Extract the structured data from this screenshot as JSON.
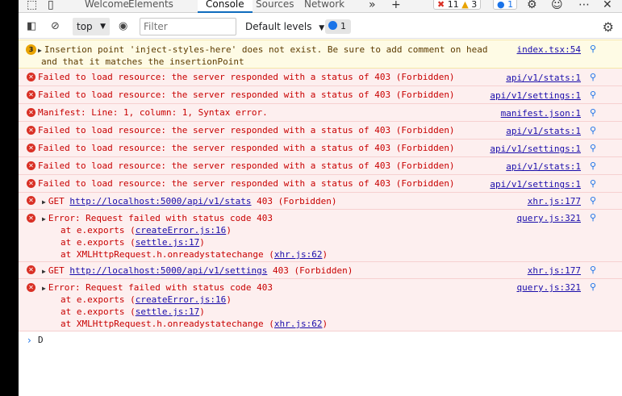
{
  "tabs": [
    {
      "label": "Welcome"
    },
    {
      "label": "Elements"
    },
    {
      "label": "Console",
      "active": true
    },
    {
      "label": "Sources"
    },
    {
      "label": "Network"
    }
  ],
  "tab_badges": {
    "errors": "11",
    "warnings": "3",
    "messages": "1"
  },
  "toolbar": {
    "context": "top",
    "filter_placeholder": "Filter",
    "levels": "Default levels",
    "message_count": "1"
  },
  "entries": [
    {
      "level": "warning",
      "badge": "3",
      "lines": [
        "Insertion point 'inject-styles-here' does not exist. Be sure to add comment on head",
        "and that it matches the insertionPoint"
      ],
      "source": "index.tsx:54"
    },
    {
      "level": "error",
      "text": "Failed to load resource: the server responded with a status of 403 (Forbidden)",
      "source": "api/v1/stats:1"
    },
    {
      "level": "error",
      "text": "Failed to load resource: the server responded with a status of 403 (Forbidden)",
      "source": "api/v1/settings:1"
    },
    {
      "level": "error",
      "text": "Manifest: Line: 1, column: 1, Syntax error.",
      "source": "manifest.json:1"
    },
    {
      "level": "error",
      "text": "Failed to load resource: the server responded with a status of 403 (Forbidden)",
      "source": "api/v1/stats:1"
    },
    {
      "level": "error",
      "text": "Failed to load resource: the server responded with a status of 403 (Forbidden)",
      "source": "api/v1/settings:1"
    },
    {
      "level": "error",
      "text": "Failed to load resource: the server responded with a status of 403 (Forbidden)",
      "source": "api/v1/stats:1"
    },
    {
      "level": "error",
      "text": "Failed to load resource: the server responded with a status of 403 (Forbidden)",
      "source": "api/v1/settings:1"
    }
  ],
  "requests": [
    {
      "method": "GET",
      "url": "http://localhost:5000/api/v1/stats",
      "status": "403 (Forbidden)",
      "source": "xhr.js:177",
      "error": {
        "message": "Error: Request failed with status code 403",
        "source": "query.js:321",
        "stack": [
          {
            "prefix": "at e.exports (",
            "link": "createError.js:16",
            "suffix": ")"
          },
          {
            "prefix": "at e.exports (",
            "link": "settle.js:17",
            "suffix": ")"
          },
          {
            "prefix": "at XMLHttpRequest.h.onreadystatechange (",
            "link": "xhr.js:62",
            "suffix": ")"
          }
        ]
      }
    },
    {
      "method": "GET",
      "url": "http://localhost:5000/api/v1/settings",
      "status": "403 (Forbidden)",
      "source": "xhr.js:177",
      "error": {
        "message": "Error: Request failed with status code 403",
        "source": "query.js:321",
        "stack": [
          {
            "prefix": "at e.exports (",
            "link": "createError.js:16",
            "suffix": ")"
          },
          {
            "prefix": "at e.exports (",
            "link": "settle.js:17",
            "suffix": ")"
          },
          {
            "prefix": "at XMLHttpRequest.h.onreadystatechange (",
            "link": "xhr.js:62",
            "suffix": ")"
          }
        ]
      }
    }
  ],
  "prompt_input": "D",
  "colors": {
    "error_text": "#c80000",
    "error_bg": "#fdefef",
    "warning_bg": "#fefbe5",
    "link": "#1a0dab",
    "accent": "#1a73e8"
  }
}
